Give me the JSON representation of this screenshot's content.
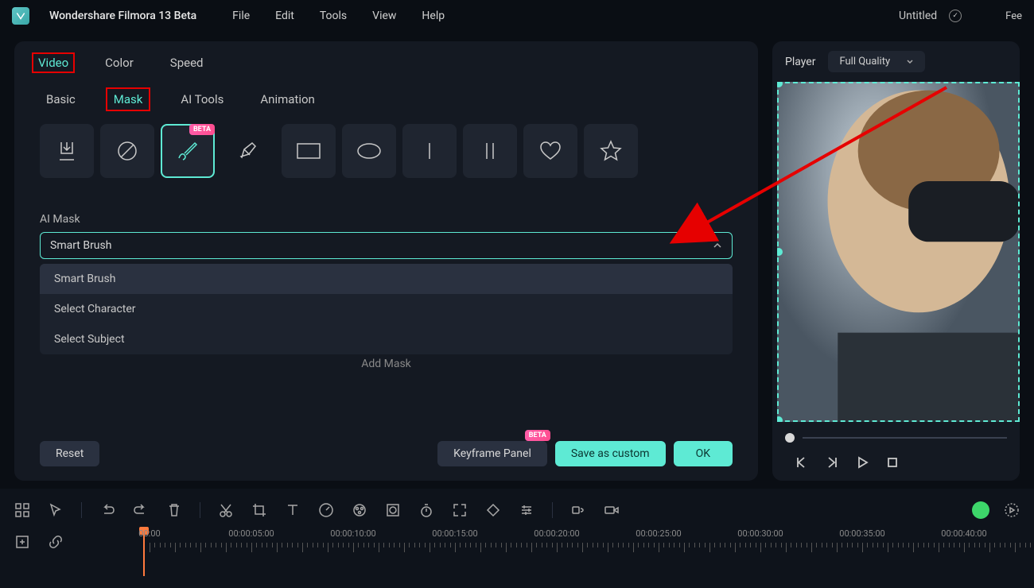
{
  "app": {
    "title": "Wondershare Filmora 13 Beta"
  },
  "menu": {
    "file": "File",
    "edit": "Edit",
    "tools": "Tools",
    "view": "View",
    "help": "Help"
  },
  "document": {
    "title": "Untitled"
  },
  "topbar": {
    "feedback": "Fee"
  },
  "panel": {
    "topTabs": {
      "video": "Video",
      "color": "Color",
      "speed": "Speed"
    },
    "subTabs": {
      "basic": "Basic",
      "mask": "Mask",
      "aiTools": "AI Tools",
      "animation": "Animation"
    },
    "betaBadge": "BETA",
    "section": {
      "label": "AI Mask"
    },
    "dropdown": {
      "selected": "Smart Brush"
    },
    "options": {
      "smartBrush": "Smart Brush",
      "selectCharacter": "Select Character",
      "selectSubject": "Select Subject"
    },
    "addMask": "Add Mask",
    "footer": {
      "reset": "Reset",
      "keyframe": "Keyframe Panel",
      "keyframeBadge": "BETA",
      "save": "Save as custom",
      "ok": "OK"
    }
  },
  "player": {
    "label": "Player",
    "quality": "Full Quality"
  },
  "timeline": {
    "labels": [
      "00:00",
      "00:00:05:00",
      "00:00:10:00",
      "00:00:15:00",
      "00:00:20:00",
      "00:00:25:00",
      "00:00:30:00",
      "00:00:35:00",
      "00:00:40:00"
    ]
  }
}
